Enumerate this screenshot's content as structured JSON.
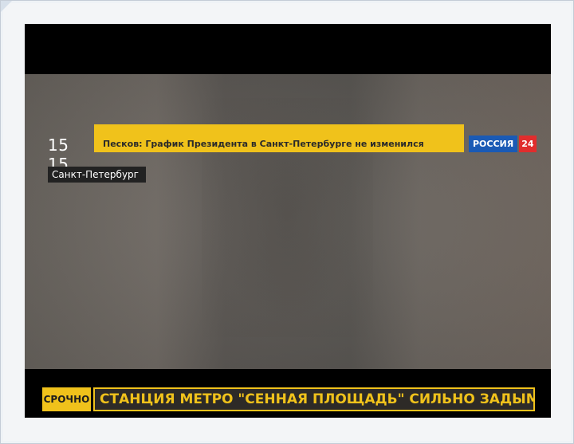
{
  "video": {
    "clock": "15 15",
    "headline": "Песков: График Президента в Санкт-Петербурге не изменился",
    "location": "Санкт-Петербург",
    "channel": {
      "name": "РОССИЯ",
      "number": "24"
    },
    "breaking": {
      "label": "СРОЧНО",
      "text": "СТАНЦИЯ МЕТРО \"СЕННАЯ ПЛОЩАДЬ\" СИЛЬНО ЗАДЫМЛЕНА"
    }
  },
  "colors": {
    "accent_yellow": "#f0c21b",
    "channel_blue": "#1a5ab5",
    "channel_red": "#e02d2d",
    "ticker_background": "#2d2a27"
  }
}
